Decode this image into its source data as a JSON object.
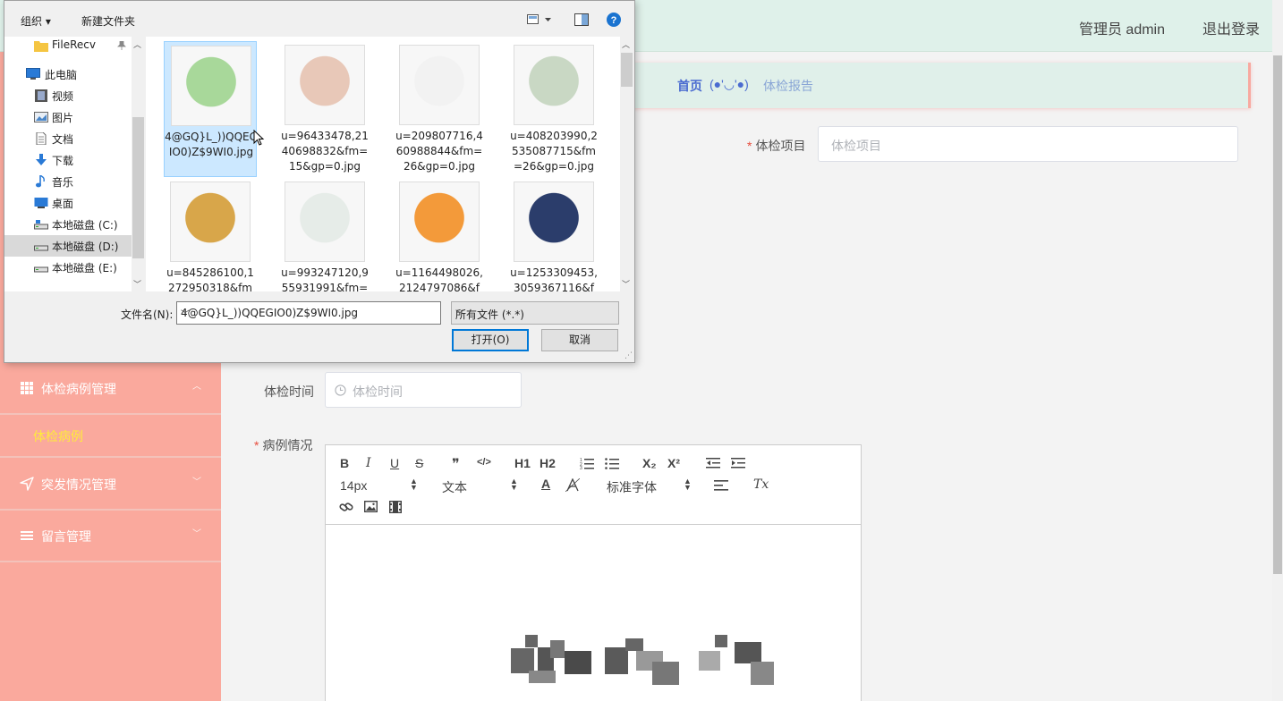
{
  "header": {
    "admin_label": "管理员 admin",
    "logout_label": "退出登录"
  },
  "breadcrumb": {
    "home": "首页",
    "face": "(●'◡'●)",
    "current": "体检报告"
  },
  "sidebar": {
    "items": [
      {
        "label": "体检病例管理",
        "icon": "grid-icon",
        "arrow": "︿"
      },
      {
        "label": "突发情况管理",
        "icon": "navigation-icon",
        "arrow": "﹀"
      },
      {
        "label": "留言管理",
        "icon": "list-icon",
        "arrow": "﹀"
      }
    ],
    "sub_item": "体检病例"
  },
  "form": {
    "project_label": "体检项目",
    "project_placeholder": "体检项目",
    "time_label": "体检时间",
    "time_placeholder": "体检时间",
    "case_label": "病例情况",
    "required_mark": "*"
  },
  "editor": {
    "font_size": "14px",
    "block_type": "文本",
    "font_family": "标准字体",
    "buttons": [
      "B",
      "I",
      "U",
      "S",
      "❞",
      "</>",
      "H1",
      "H2",
      "ordered-list",
      "bullet-list",
      "X₂",
      "X²",
      "outdent",
      "indent",
      "A",
      "background",
      "align",
      "Tx",
      "link",
      "image",
      "video"
    ]
  },
  "dialog": {
    "organize": "组织 ▾",
    "new_folder": "新建文件夹",
    "nav": [
      {
        "label": "FileRecv",
        "icon": "folder-icon",
        "pinned": true
      },
      {
        "label": "此电脑",
        "icon": "computer-icon"
      },
      {
        "label": "视频",
        "icon": "video-icon"
      },
      {
        "label": "图片",
        "icon": "picture-icon"
      },
      {
        "label": "文档",
        "icon": "document-icon"
      },
      {
        "label": "下载",
        "icon": "download-icon"
      },
      {
        "label": "音乐",
        "icon": "music-icon"
      },
      {
        "label": "桌面",
        "icon": "desktop-icon"
      },
      {
        "label": "本地磁盘 (C:)",
        "icon": "drive-icon"
      },
      {
        "label": "本地磁盘 (D:)",
        "icon": "drive-icon",
        "selected": true
      },
      {
        "label": "本地磁盘 (E:)",
        "icon": "drive-icon"
      }
    ],
    "files": [
      {
        "name": "4@GQ}L_))QQEGIO0)Z$9WI0.jpg",
        "color": "#a8d89a",
        "selected": true
      },
      {
        "name": "u=96433478,2140698832&fm=15&gp=0.jpg",
        "color": "#e8c8b8"
      },
      {
        "name": "u=209807716,460988844&fm=26&gp=0.jpg",
        "color": "#f2f2f2"
      },
      {
        "name": "u=408203990,2535087715&fm=26&gp=0.jpg",
        "color": "#c9d8c4"
      },
      {
        "name": "u=845286100,1272950318&fm",
        "color": "#d8a64a"
      },
      {
        "name": "u=993247120,955931991&fm=",
        "color": "#e6ece8"
      },
      {
        "name": "u=1164498026,2124797086&f",
        "color": "#f39a3a"
      },
      {
        "name": "u=1253309453,3059367116&f",
        "color": "#2b3d6b"
      }
    ],
    "filename_label": "文件名(N):",
    "filename_value": "4@GQ}L_))QQEGIO0)Z$9WI0.jpg",
    "filetype_value": "所有文件 (*.*)",
    "open_label": "打开(O)",
    "cancel_label": "取消"
  },
  "colors": {
    "sidebar": "#faa99d",
    "header": "#dff1ea",
    "accent": "#4a6bd0",
    "highlight": "#ffeb3b"
  }
}
